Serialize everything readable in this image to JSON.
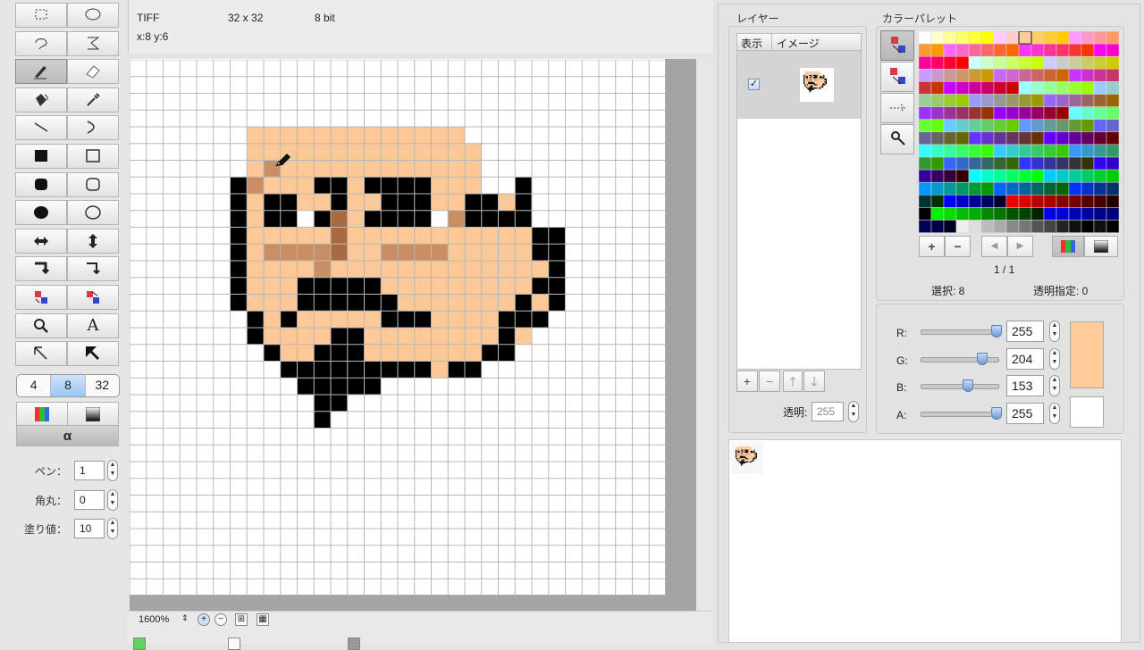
{
  "image_info": {
    "format": "TIFF",
    "size": "32 x 32",
    "depth": "8 bit",
    "cursor_pos": "x:8 y:6"
  },
  "tools": {
    "rows": [
      [
        "rect-select-icon",
        "ellipse-select-icon"
      ],
      [
        "lasso-icon",
        "magic-lasso-icon"
      ],
      [
        "pencil-icon",
        "eraser-icon"
      ],
      [
        "fill-bucket-icon",
        "eyedropper-icon"
      ],
      [
        "line-icon",
        "curve-icon"
      ],
      [
        "filled-rect-icon",
        "rect-outline-icon"
      ],
      [
        "filled-rounded-rect-icon",
        "rounded-rect-icon"
      ],
      [
        "filled-ellipse-icon",
        "ellipse-icon"
      ],
      [
        "flip-horizontal-icon",
        "flip-vertical-icon"
      ],
      [
        "rotate-left-icon",
        "rotate-right-icon"
      ],
      [
        "swap-colors-icon",
        "swap-colors-alt-icon"
      ],
      [
        "zoom-icon",
        "text-icon"
      ],
      [
        "select-arrow-icon",
        "select-arrow-filled-icon"
      ]
    ],
    "selected": "pencil-icon",
    "text_tool_glyph": "A",
    "grid_options": [
      "4",
      "8",
      "32"
    ],
    "grid_selected": "8",
    "alpha_label": "α"
  },
  "settings": [
    {
      "label": "ペン：",
      "value": "1"
    },
    {
      "label": "角丸：",
      "value": "0"
    },
    {
      "label": "塗り値：",
      "value": "10"
    }
  ],
  "status": {
    "zoom": "1600%"
  },
  "layers": {
    "title": "レイヤー",
    "col_show": "表示",
    "col_image": "イメージ",
    "opacity_label": "透明:",
    "opacity_value": "255"
  },
  "palette": {
    "title": "カラーパレット",
    "page": "1 / 1",
    "selected_label": "選択: 8",
    "transparent_label": "透明指定: 0"
  },
  "rgba": {
    "r_label": "R:",
    "r": "255",
    "g_label": "G:",
    "g": "204",
    "b_label": "B:",
    "b": "153",
    "a_label": "A:",
    "a": "255",
    "current_color": "#ffcc99",
    "background_color": "#ffffff"
  },
  "sprite": {
    "width": 32,
    "height": 32,
    "origin_col": 0,
    "rows": [
      "..............................",
      "..............................",
      "..............................",
      "..............................",
      ".......SSSSSSSSSSSSS..........",
      ".......SSSSSSSSSSSSSS.........",
      ".......SKSSSSSSSSSSSS.........",
      "......XKSSSXXSXXXXSSS..X......",
      "......XSXXSSXSSXXXSSXXSX......",
      "......XSXXWXLSXXXXWKXXXX......",
      "......XSSSSSLSSSSSSSSSSSXX....",
      "......XSKKKKLSSKKKKSSSSSXX....",
      "......XSSSSKSSSSSSSSSSSSSX....",
      "......XSSSXXXXXSSSSSSSSSXX....",
      "......XSSSXXXXXXSSSSSSSXSX....",
      ".......XSXSSSSSXXXSSSSXXX.....",
      ".......XSSSSXXSSSSSSSSXS......",
      "........XSSXXXSSSSSSSXX.......",
      ".........XXXXXXXXXSXX.........",
      "..........XXXXX...............",
      "...........XX.................",
      "...........X..................",
      "..............................",
      "..............................",
      "..............................",
      "..............................",
      "..............................",
      "..............................",
      "..............................",
      "..............................",
      "..............................",
      ".............................."
    ],
    "colors": {
      "S": "#fcc898",
      "K": "#c98f62",
      "L": "#a86b3f",
      "X": "#000000",
      "W": "#ffffff"
    }
  }
}
